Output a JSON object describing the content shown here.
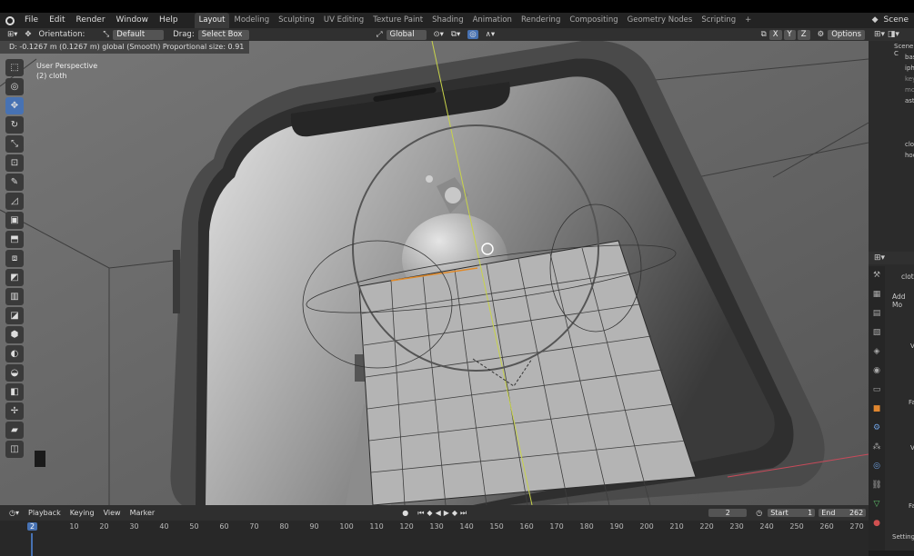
{
  "menu": {
    "items": [
      "File",
      "Edit",
      "Render",
      "Window",
      "Help"
    ],
    "workspaces": [
      "Layout",
      "Modeling",
      "Sculpting",
      "UV Editing",
      "Texture Paint",
      "Shading",
      "Animation",
      "Rendering",
      "Compositing",
      "Geometry Nodes",
      "Scripting"
    ],
    "active_workspace": "Layout",
    "add_tab": "+",
    "scene": "Scene"
  },
  "header": {
    "orientation_label": "Orientation:",
    "orientation_value": "Default",
    "drag_label": "Drag:",
    "drag_value": "Select Box",
    "transform_orientation": "Global",
    "axes": [
      "X",
      "Y",
      "Z"
    ],
    "options": "Options"
  },
  "viewport": {
    "operator_info": "D: -0.1267 m (0.1267 m) global (Smooth)   Proportional size: 0.91",
    "view_name": "User Perspective",
    "object_name": "(2) cloth"
  },
  "outliner": {
    "items": [
      "Scene C",
      "bas",
      "iph",
      "key",
      "mo",
      "ast",
      "clo",
      "hoo"
    ]
  },
  "properties": {
    "object": "clot",
    "add_modifier": "Add Mo",
    "labels": [
      "V",
      "Fa",
      "V",
      "Fa",
      "Settings"
    ]
  },
  "timeline": {
    "menus": [
      "Playback",
      "Keying",
      "View",
      "Marker"
    ],
    "current_frame": "2",
    "start_label": "Start",
    "start": "1",
    "end_label": "End",
    "end": "262",
    "ruler_ticks": [
      "2",
      "10",
      "20",
      "30",
      "40",
      "50",
      "60",
      "70",
      "80",
      "90",
      "100",
      "110",
      "120",
      "130",
      "140",
      "150",
      "160",
      "170",
      "180",
      "190",
      "200",
      "210",
      "220",
      "230",
      "240",
      "250",
      "260",
      "270"
    ]
  },
  "colors": {
    "accent": "#4772b3",
    "viewport_bg": "#6c6c6c",
    "y_axis": "#c8d34a",
    "x_axis": "#c84a5a",
    "selection": "#e08a2a"
  }
}
